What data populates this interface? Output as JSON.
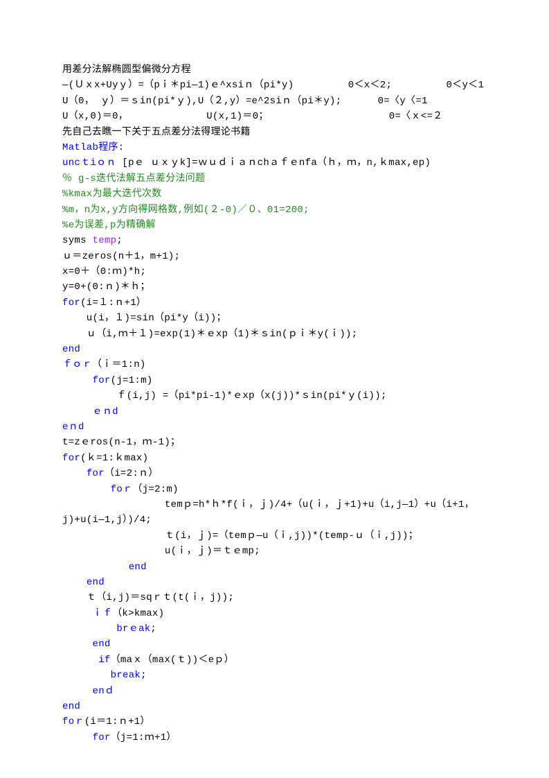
{
  "lines": [
    {
      "cls": "black",
      "text": "用差分法解椭圆型偏微分方程"
    },
    {
      "cls": "black",
      "text": "—(Ｕｘx+Uyｙ）=（pｉ＊pi—1)ｅ^xsiｎ（pi*y)         0＜x＜2;         0＜y＜1"
    },
    {
      "cls": "black",
      "text": "U（0， ｙ）＝ｓin(pi*ｙ),U（２,y）=e^2siｎ（pi＊y);      0=〈y〈=1"
    },
    {
      "cls": "black",
      "text": "U（x,0)＝0，             U(x,1)＝0；                    0=〈ｘ<=２"
    },
    {
      "cls": "black",
      "text": "先自己去瞧一下关于五点差分法得理论书籍"
    },
    {
      "cls": "blue",
      "text": "Matlab程序:"
    },
    {
      "segments": [
        {
          "cls": "blue",
          "text": "uncｔiｏｎ "
        },
        {
          "cls": "black",
          "text": "[pｅ ｕｘｙk]=ｗｕｄｉａｎchａｆｅnfa（ｈ，ｍ，n,ｋmax,ep)"
        }
      ]
    },
    {
      "cls": "green",
      "text": "％ g-s迭代法解五点差分法问题"
    },
    {
      "cls": "green",
      "text": "%kmax为最大迭代次数"
    },
    {
      "cls": "green",
      "text": "%m，n为x,y方向得网格数,例如(２-0)／０、01=200;"
    },
    {
      "cls": "green",
      "text": "%e为误差,p为精确解"
    },
    {
      "segments": [
        {
          "cls": "black",
          "text": "syms "
        },
        {
          "cls": "purple",
          "text": "temp"
        },
        {
          "cls": "black",
          "text": ";"
        }
      ]
    },
    {
      "cls": "black",
      "text": "ｕ＝zeros(n＋1，m+1);"
    },
    {
      "cls": "black",
      "text": "x=0＋（0:ｍ)*h;"
    },
    {
      "cls": "black",
      "text": "y=0+(0:ｎ)＊ｈ；"
    },
    {
      "segments": [
        {
          "cls": "blue",
          "text": "for"
        },
        {
          "cls": "black",
          "text": "(i=１:ｎ+1）"
        }
      ]
    },
    {
      "cls": "black",
      "text": "    u(i，１)=sin（pi*y（i))；"
    },
    {
      "cls": "black",
      "text": "    ｕ（i,ｍ＋１)=exp(1)＊ｅxp（1)＊ｓin(ｐｉ＊y(ｉ));"
    },
    {
      "cls": "blue",
      "text": "end"
    },
    {
      "segments": [
        {
          "cls": "blue",
          "text": "ｆｏｒ"
        },
        {
          "cls": "black",
          "text": "（ｉ＝1:n)"
        }
      ]
    },
    {
      "segments": [
        {
          "cls": "black",
          "text": "     "
        },
        {
          "cls": "blue",
          "text": "for"
        },
        {
          "cls": "black",
          "text": "(j=1:m)"
        }
      ]
    },
    {
      "cls": "black",
      "text": "         ｆ(i,j) =（pi*pi-1)*ｅxp（x(j))*ｓin(pi*ｙ(i));"
    },
    {
      "segments": [
        {
          "cls": "black",
          "text": "     "
        },
        {
          "cls": "blue",
          "text": "ｅｎd"
        }
      ]
    },
    {
      "cls": "blue",
      "text": "eｎd"
    },
    {
      "cls": "black",
      "text": "t=zｅros(n-1，ｍ-1)；"
    },
    {
      "segments": [
        {
          "cls": "blue",
          "text": "for"
        },
        {
          "cls": "black",
          "text": "(ｋ=1:ｋmax)"
        }
      ]
    },
    {
      "segments": [
        {
          "cls": "black",
          "text": "    "
        },
        {
          "cls": "blue",
          "text": "for"
        },
        {
          "cls": "black",
          "text": "（i=2:ｎ）"
        }
      ]
    },
    {
      "segments": [
        {
          "cls": "black",
          "text": "        "
        },
        {
          "cls": "blue",
          "text": "foｒ"
        },
        {
          "cls": "black",
          "text": "（j=2:m)"
        }
      ]
    },
    {
      "cls": "black",
      "text": "                 temｐ=h*ｈ*f(ｉ，ｊ)/4+（u(ｉ，ｊ+1)+u（i,j—1）+u（i+1，"
    },
    {
      "cls": "black",
      "text": "j)+u(i—1,j）)/4;"
    },
    {
      "cls": "black",
      "text": "                 ｔ(i，ｊ)=（temｐ—u（ｉ,j))*(temp-ｕ（ｉ,j))；"
    },
    {
      "cls": "black",
      "text": "                 u(ｉ，ｊ)＝ｔｅmp;"
    },
    {
      "segments": [
        {
          "cls": "black",
          "text": "           "
        },
        {
          "cls": "blue",
          "text": "end"
        }
      ]
    },
    {
      "segments": [
        {
          "cls": "black",
          "text": "    "
        },
        {
          "cls": "blue",
          "text": "end"
        }
      ]
    },
    {
      "cls": "black",
      "text": "    ｔ（i,j)＝sqｒｔ(t(ｉ，j));"
    },
    {
      "segments": [
        {
          "cls": "black",
          "text": "     "
        },
        {
          "cls": "blue",
          "text": "ｉｆ"
        },
        {
          "cls": "black",
          "text": "（k>kmax)"
        }
      ]
    },
    {
      "segments": [
        {
          "cls": "black",
          "text": "         "
        },
        {
          "cls": "blue",
          "text": "brｅak"
        },
        {
          "cls": "black",
          "text": ";"
        }
      ]
    },
    {
      "segments": [
        {
          "cls": "black",
          "text": "     "
        },
        {
          "cls": "blue",
          "text": "end"
        }
      ]
    },
    {
      "segments": [
        {
          "cls": "black",
          "text": "      "
        },
        {
          "cls": "blue",
          "text": "if"
        },
        {
          "cls": "black",
          "text": "（maｘ（max(ｔ))＜eｐ）"
        }
      ]
    },
    {
      "segments": [
        {
          "cls": "black",
          "text": "        "
        },
        {
          "cls": "blue",
          "text": "break"
        },
        {
          "cls": "black",
          "text": ";"
        }
      ]
    },
    {
      "segments": [
        {
          "cls": "black",
          "text": "     "
        },
        {
          "cls": "blue",
          "text": "enｄ"
        }
      ]
    },
    {
      "cls": "blue",
      "text": "end"
    },
    {
      "segments": [
        {
          "cls": "blue",
          "text": "foｒ"
        },
        {
          "cls": "black",
          "text": "(i＝1:ｎ+1）"
        }
      ]
    },
    {
      "segments": [
        {
          "cls": "black",
          "text": "     "
        },
        {
          "cls": "blue",
          "text": "for"
        },
        {
          "cls": "black",
          "text": "（j=1:ｍ+1）"
        }
      ]
    }
  ]
}
